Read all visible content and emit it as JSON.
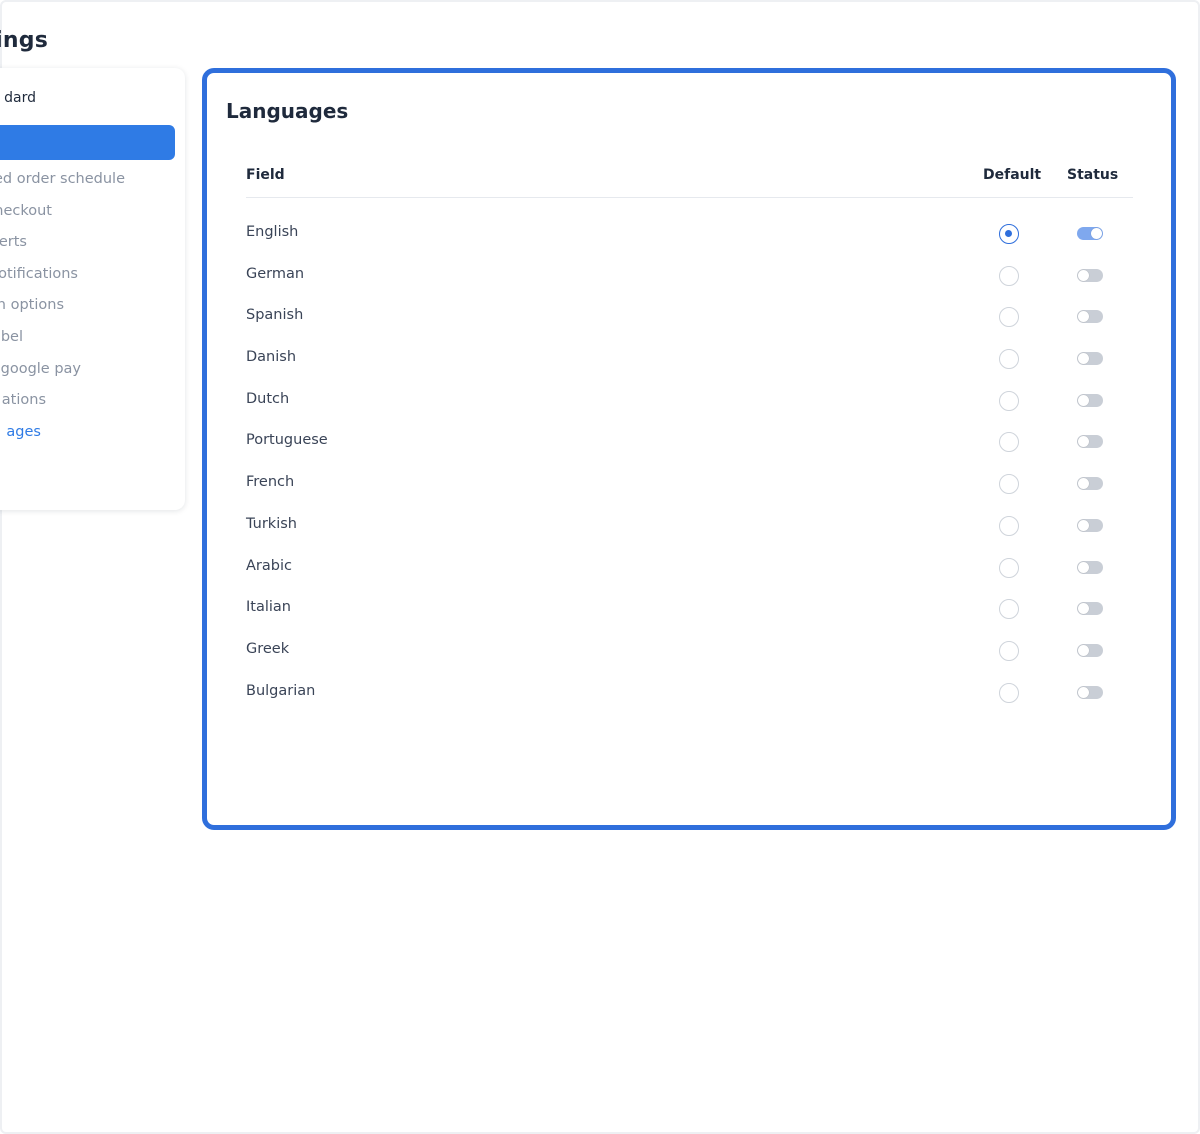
{
  "page": {
    "title": "ings"
  },
  "sidebar": {
    "header": "dard",
    "items": [
      {
        "label": "nced order schedule"
      },
      {
        "label": "checkout"
      },
      {
        "label": "alerts"
      },
      {
        "label": "notifications"
      },
      {
        "label": "login options"
      },
      {
        "label": "label"
      },
      {
        "label": "& google pay"
      },
      {
        "label": "ations"
      },
      {
        "label": "ages"
      }
    ]
  },
  "card": {
    "title": "Languages",
    "columns": {
      "field": "Field",
      "default": "Default",
      "status": "Status"
    },
    "languages": [
      {
        "name": "English",
        "default": true,
        "status": true
      },
      {
        "name": "German",
        "default": false,
        "status": false
      },
      {
        "name": "Spanish",
        "default": false,
        "status": false
      },
      {
        "name": "Danish",
        "default": false,
        "status": false
      },
      {
        "name": "Dutch",
        "default": false,
        "status": false
      },
      {
        "name": "Portuguese",
        "default": false,
        "status": false
      },
      {
        "name": "French",
        "default": false,
        "status": false
      },
      {
        "name": "Turkish",
        "default": false,
        "status": false
      },
      {
        "name": "Arabic",
        "default": false,
        "status": false
      },
      {
        "name": "Italian",
        "default": false,
        "status": false
      },
      {
        "name": "Greek",
        "default": false,
        "status": false
      },
      {
        "name": "Bulgarian",
        "default": false,
        "status": false
      }
    ]
  },
  "colors": {
    "accent": "#2f7be5",
    "border_highlight": "#2f6fdc",
    "toggle_on": "#7fa8ee",
    "toggle_off": "#c9ced6"
  }
}
